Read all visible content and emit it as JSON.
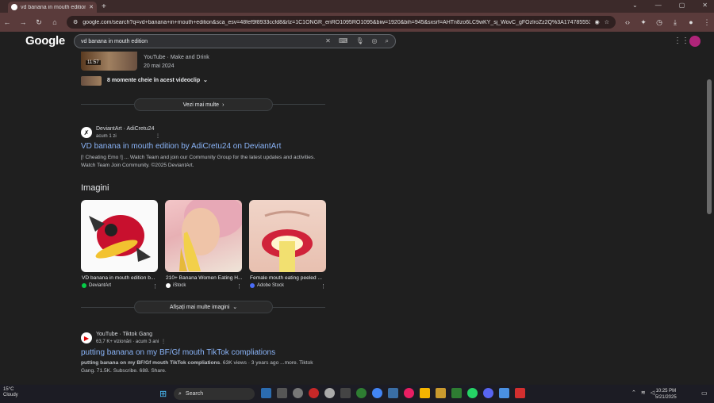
{
  "browser": {
    "tab_title": "vd banana in mouth edition - G",
    "url": "google.com/search?q=vd+banana+in+mouth+edition&sca_esv=48fef9f8933ccfd8&rlz=1C1ONGR_enRO1095RO1095&biw=1920&bih=945&sxsrf=AHTn8zo6LC9wKY_sj_WovC_gFOzlroZz2Q%3A1747855537694&ei=sSgu..."
  },
  "google": {
    "logo": "Google",
    "query": "vd banana in mouth edition"
  },
  "video_result": {
    "duration": "11:57",
    "source": "YouTube · Make and Drink",
    "date": "20 mai 2024",
    "moments": "8 momente cheie în acest videoclip",
    "more_label": "Vezi mai multe"
  },
  "deviantart_result": {
    "site": "DeviantArt · AdiCretu24",
    "time": "acum 1 zi",
    "title": "VD banana in mouth edition by AdiCretu24 on DeviantArt",
    "snippet": "[! Cheating Emo !] ... Watch Team and join our Community Group for the latest updates and activities. Watch Team Join Community. ©2025 DeviantArt."
  },
  "images": {
    "heading": "Imagini",
    "items": [
      {
        "caption": "VD banana in mouth edition b...",
        "source": "DeviantArt"
      },
      {
        "caption": "210+ Banana Women Eating H...",
        "source": "iStock"
      },
      {
        "caption": "Female mouth eating peeled ...",
        "source": "Adobe Stock"
      }
    ],
    "more_label": "Afișați mai multe imagini"
  },
  "tiktok_result": {
    "site": "YouTube · Tiktok Gang",
    "views": "63,7 K+ vizionări · acum 3 ani",
    "title": "putting banana on my BF/Gf mouth TikTok compliations",
    "snippet_bold": "putting banana on my BF/Gf mouth TikTok compliations",
    "snippet_rest": ". 63K views · 3 years ago ...more. Tiktok Gang. 71.5K. Subscribe. 688. Share."
  },
  "taskbar": {
    "temp": "15°C",
    "weather": "Cloudy",
    "search": "Search",
    "time": "10:25 PM",
    "date": "5/21/2025"
  }
}
